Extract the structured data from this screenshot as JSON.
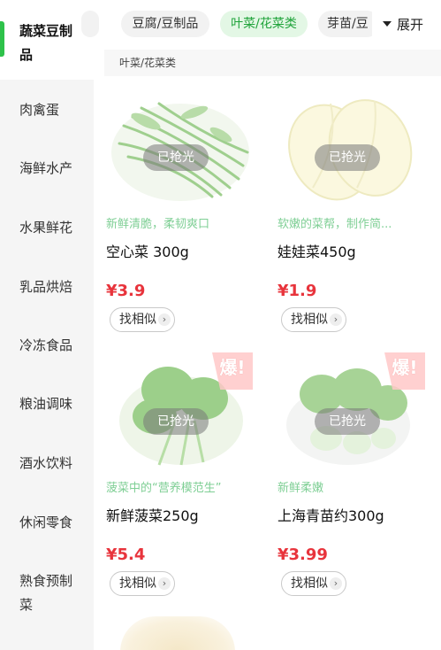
{
  "sidebar": {
    "items": [
      {
        "label": "蔬菜豆制\n品",
        "active": true
      },
      {
        "label": "肉禽蛋"
      },
      {
        "label": "海鲜水产"
      },
      {
        "label": "水果鲜花"
      },
      {
        "label": "乳品烘焙"
      },
      {
        "label": "冷冻食品"
      },
      {
        "label": "粮油调味"
      },
      {
        "label": "酒水饮料"
      },
      {
        "label": "休闲零食"
      },
      {
        "label": "熟食预制\n菜"
      }
    ]
  },
  "tabs": [
    {
      "label": "豆腐/豆制品"
    },
    {
      "label": "叶菜/花菜类",
      "active": true
    },
    {
      "label": "芽苗/豆"
    }
  ],
  "expand_label": "展开",
  "breadcrumb": "叶菜/花菜类",
  "products": [
    {
      "slogan": "新鲜清脆，柔韧爽口",
      "name": "空心菜 300g",
      "price": "¥3.9",
      "soldout": "已抢光",
      "similar": "找相似",
      "hot": false,
      "image_icon": "water-spinach-icon"
    },
    {
      "slogan": "软嫩的菜帮，制作简...",
      "name": "娃娃菜450g",
      "price": "¥1.9",
      "soldout": "已抢光",
      "similar": "找相似",
      "hot": false,
      "image_icon": "baby-cabbage-icon"
    },
    {
      "slogan": "菠菜中的“营养模范生”",
      "name": "新鲜菠菜250g",
      "price": "¥5.4",
      "soldout": "已抢光",
      "similar": "找相似",
      "hot": true,
      "hot_label": "爆!",
      "image_icon": "spinach-icon"
    },
    {
      "slogan": "新鲜柔嫩",
      "name": "上海青苗约300g",
      "price": "¥3.99",
      "soldout": "已抢光",
      "similar": "找相似",
      "hot": true,
      "hot_label": "爆!",
      "image_icon": "bok-choy-icon"
    }
  ],
  "colors": {
    "accent": "#2ec24a",
    "price": "#e8343c",
    "slogan": "#7fcf95",
    "sidebar_bg": "#f5f5f5"
  }
}
